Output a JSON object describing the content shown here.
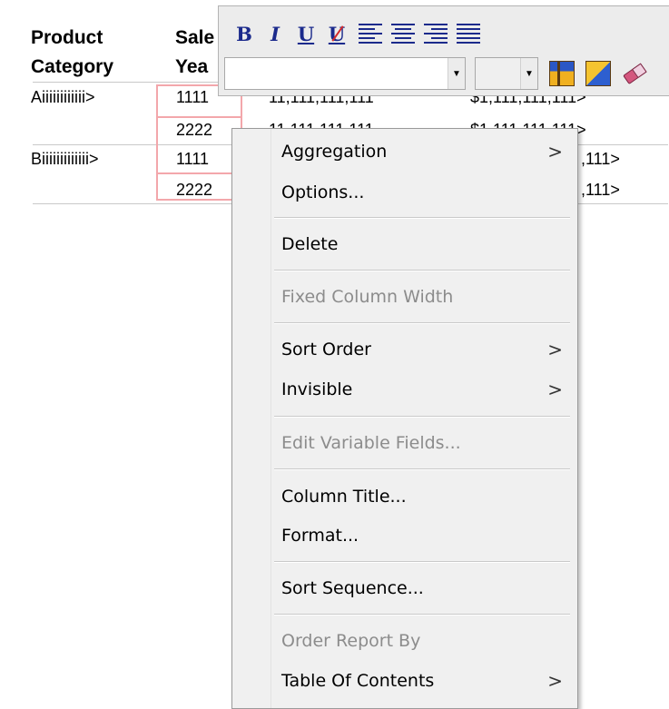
{
  "report": {
    "headers": {
      "category_line1": "Product",
      "category_line2": "Category",
      "sales_line1": "Sale",
      "sales_line2": "Yea"
    },
    "rows": [
      {
        "category": "Aiiiiiiiiiiii>",
        "year": "1111",
        "qty": "11,111,111,111",
        "amount": "$1,111,111,111>"
      },
      {
        "category": "",
        "year": "2222",
        "qty": "11,111,111,111",
        "amount": "$1,111,111,111>"
      },
      {
        "category": "Biiiiiiiiiiiii>",
        "year": "1111",
        "qty": "",
        "amount": ",111>"
      },
      {
        "category": "",
        "year": "2222",
        "qty": "",
        "amount": ",111>"
      }
    ]
  },
  "toolbar": {
    "bold_label": "B",
    "italic_label": "I",
    "underline_label": "U",
    "strike_label": "U",
    "font_value": "",
    "size_value": ""
  },
  "context_menu": {
    "items": [
      {
        "label": "Aggregation",
        "submenu": ">",
        "enabled": true
      },
      {
        "label": "Options...",
        "enabled": true
      },
      {
        "label": "Delete",
        "enabled": true
      },
      {
        "label": "Fixed Column Width",
        "enabled": false
      },
      {
        "label": "Sort Order",
        "submenu": ">",
        "enabled": true
      },
      {
        "label": "Invisible",
        "submenu": ">",
        "enabled": true
      },
      {
        "label": "Edit Variable Fields...",
        "enabled": false
      },
      {
        "label": "Column Title...",
        "enabled": true
      },
      {
        "label": "Format...",
        "enabled": true
      },
      {
        "label": "Sort Sequence...",
        "enabled": true
      },
      {
        "label": "Order Report By",
        "enabled": false
      },
      {
        "label": "Table Of Contents",
        "submenu": ">",
        "enabled": true
      }
    ]
  },
  "colors": {
    "selection_border": "#f3a7ab",
    "toolbar_icon": "#1b2a8c",
    "disabled_text": "#8c8c8c"
  },
  "icons": [
    "bold-icon",
    "italic-icon",
    "underline-icon",
    "strikethrough-icon",
    "align-left-icon",
    "align-center-icon",
    "align-right-icon",
    "justify-icon",
    "table-color-icon",
    "fill-color-icon",
    "eraser-icon",
    "chevron-right-icon"
  ]
}
